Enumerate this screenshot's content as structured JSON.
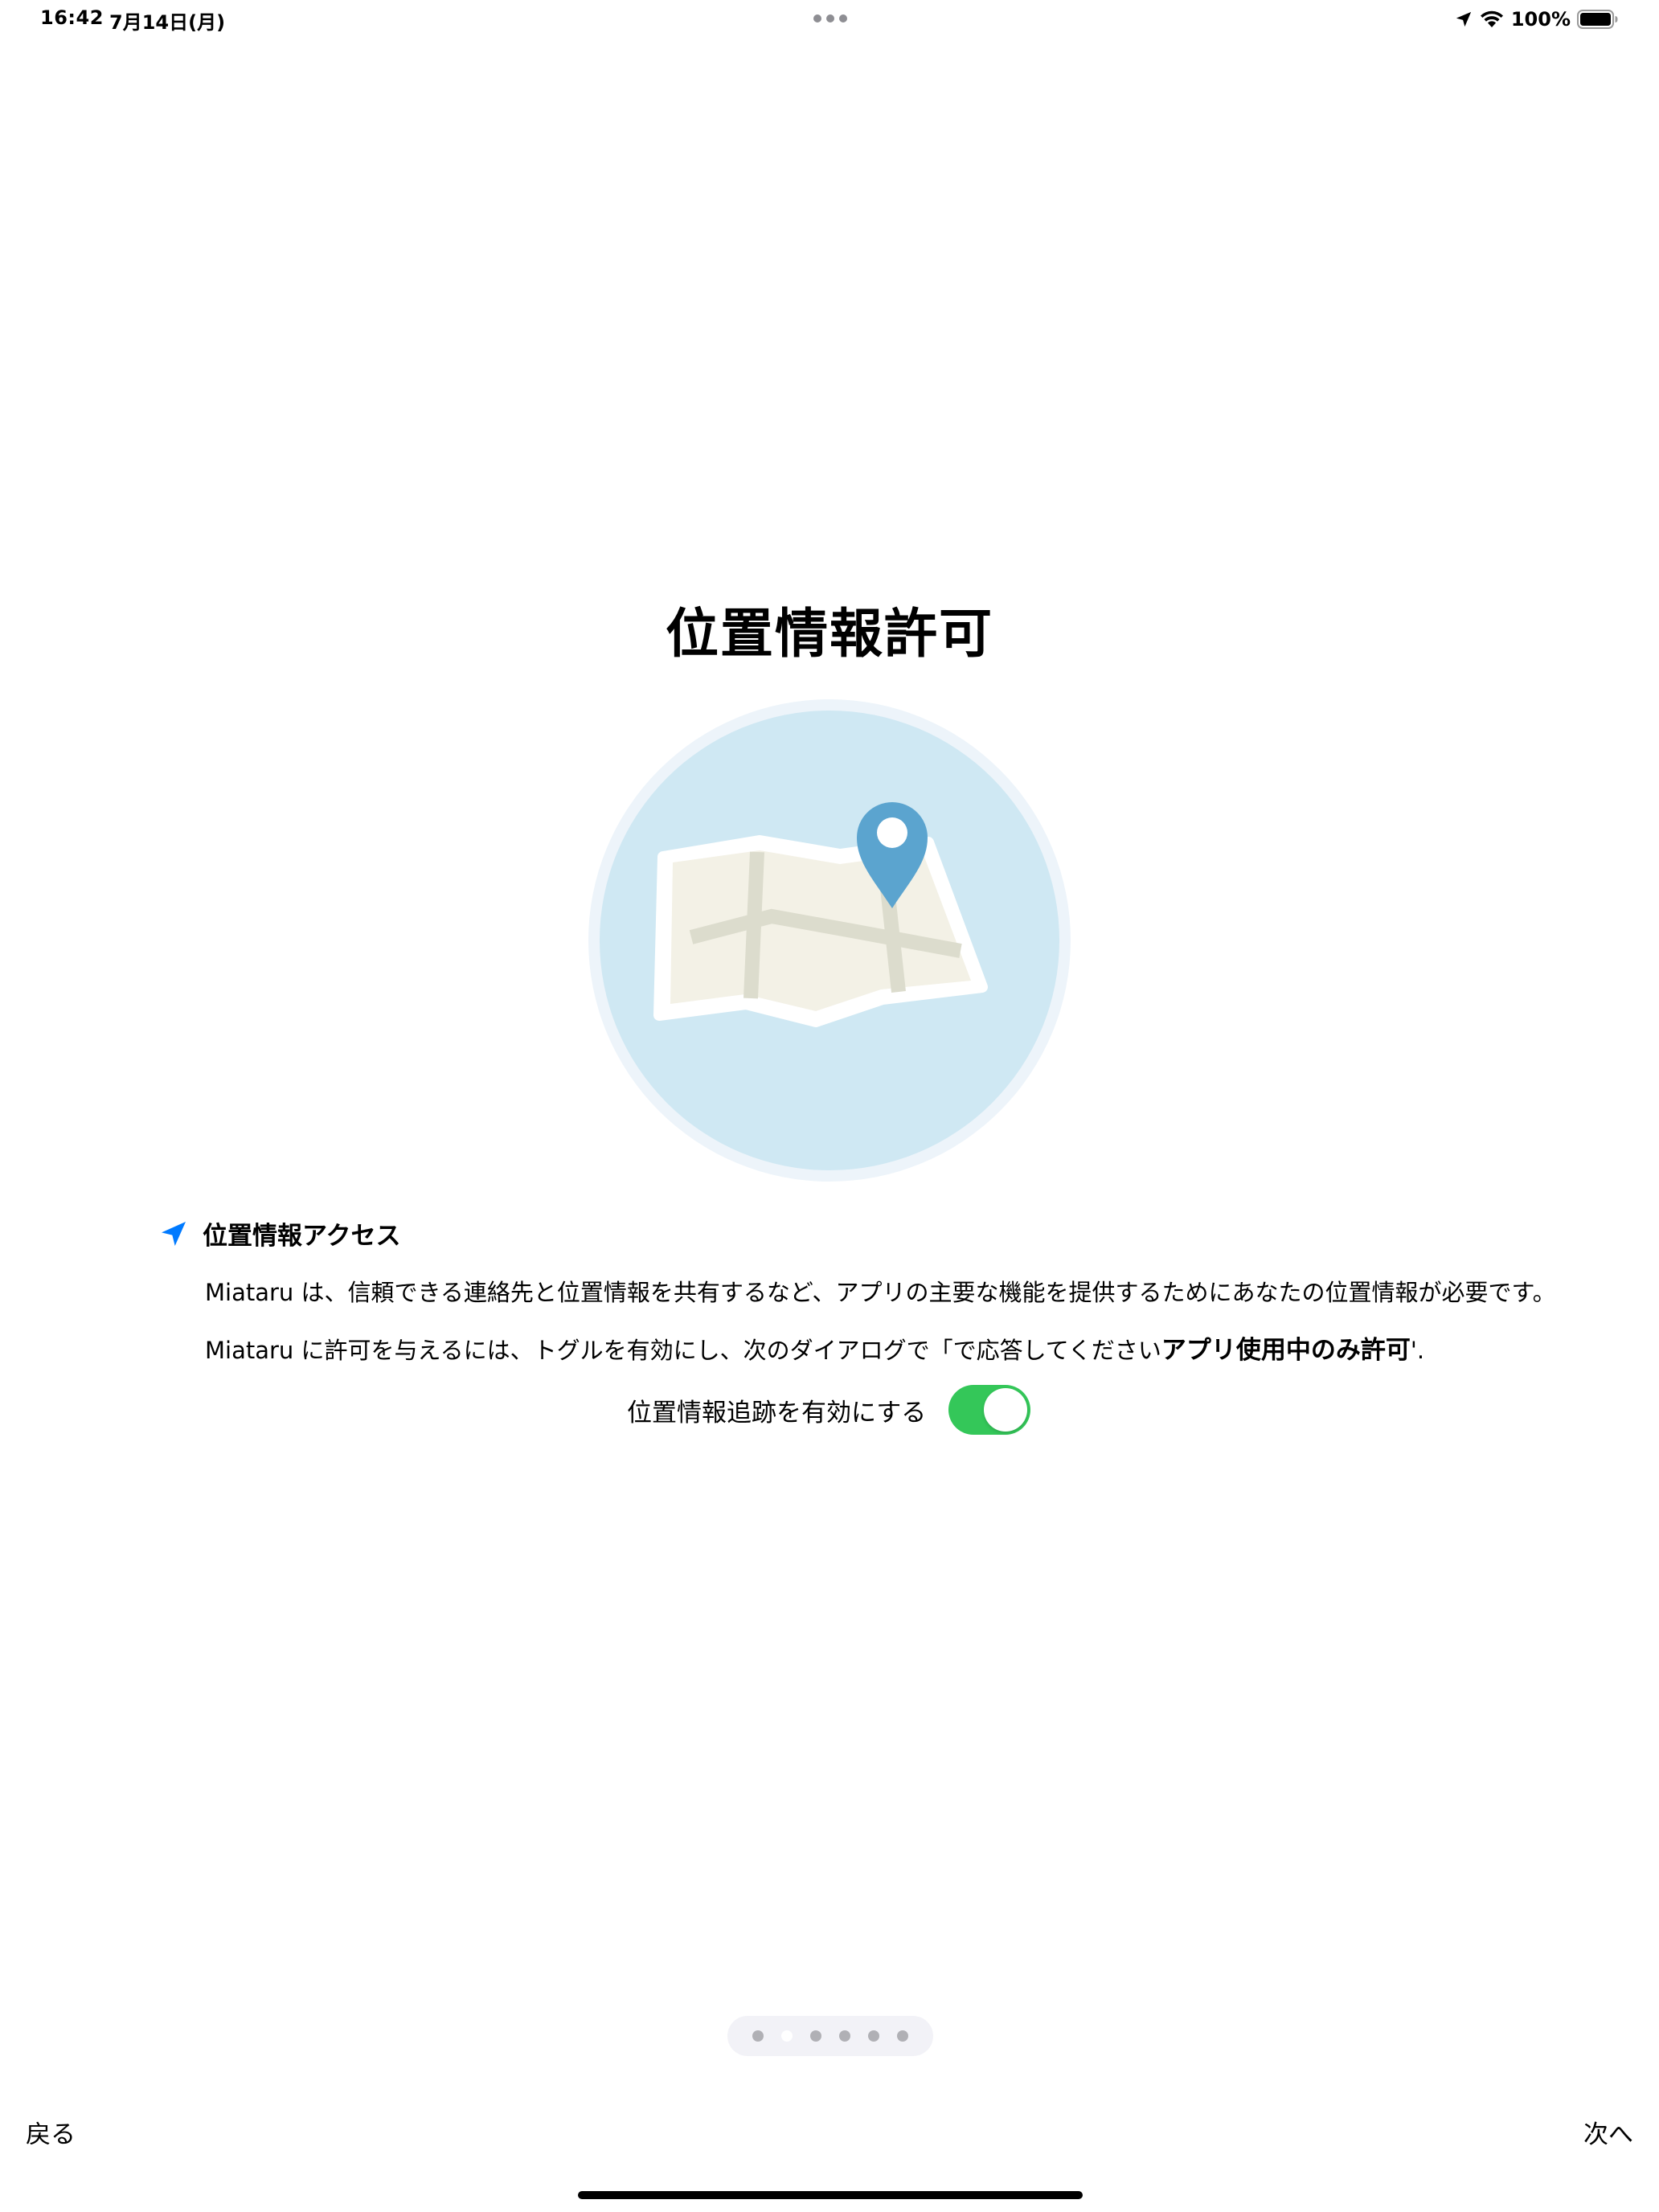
{
  "status_bar": {
    "time": "16:42",
    "date": "7月14日(月)",
    "battery_percent": "100%",
    "icons": [
      "location-arrow-icon",
      "wifi-icon",
      "battery-icon"
    ]
  },
  "onboarding": {
    "title": "位置情報許可",
    "illustration_icon": "map-pin-icon",
    "section_icon": "location-arrow-icon",
    "section_title": "位置情報アクセス",
    "description": "Miataru は、信頼できる連絡先と位置情報を共有するなど、アプリの主要な機能を提供するためにあなたの位置情報が必要です。",
    "instruction_prefix": "Miataru に許可を与えるには、トグルを有効にし、次のダイアログで「で応答してください",
    "instruction_strong": "アプリ使用中のみ許可",
    "instruction_suffix": "'.",
    "toggle_label": "位置情報追跡を有効にする",
    "toggle_on": true
  },
  "pagination": {
    "total_pages": 6,
    "current_index": 1
  },
  "navigation": {
    "back_label": "戻る",
    "next_label": "次へ"
  },
  "colors": {
    "accent_blue": "#007aff",
    "toggle_green": "#34c759",
    "pin_blue": "#5ba4cf",
    "circle_fill": "#cfe8f3"
  }
}
